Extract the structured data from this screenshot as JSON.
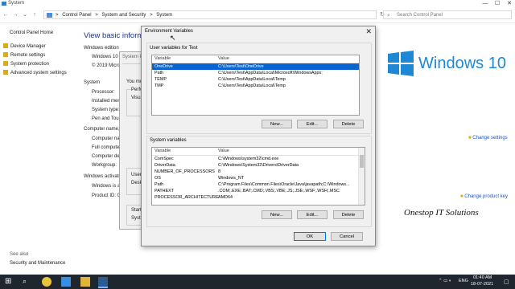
{
  "window": {
    "title": "System",
    "controls": [
      "—",
      "☐",
      "✕"
    ]
  },
  "address": {
    "path_items": [
      "Control Panel",
      "System and Security",
      "System"
    ],
    "separator": ">",
    "search_placeholder": "Search Control Panel"
  },
  "left_pane": {
    "home": "Control Panel Home",
    "links": [
      "Device Manager",
      "Remote settings",
      "System protection",
      "Advanced system settings"
    ],
    "see_also": "See also",
    "security": "Security and Maintenance"
  },
  "main": {
    "heading": "View basic information",
    "windows_edition": "Windows edition",
    "edition_value": "Windows 10 P",
    "copyright": "© 2019 Micros",
    "system_section": "System",
    "system_labels": [
      "Processor:",
      "Installed mem",
      "System type:",
      "Pen and Touch"
    ],
    "computer_section": "Computer name, d",
    "computer_labels": [
      "Computer nam",
      "Full compute",
      "Computer des",
      "Workgroup:"
    ],
    "activation_section": "Windows activatio",
    "activation_labels": [
      "Windows is ac",
      "Product ID: 00"
    ],
    "change_settings": "Change settings",
    "change_product_key": "Change product key",
    "win10_text": "Windows 10",
    "brand": "Onestop IT Solutions"
  },
  "bg_dialog": {
    "title": "System Pro",
    "lines": [
      "You mu",
      "Perfor",
      "Visua",
      "User P",
      "Deskt",
      "Startu",
      "Syste"
    ]
  },
  "env_dialog": {
    "title": "Environment Variables",
    "user_group": "User variables for Test",
    "columns": [
      "Variable",
      "Value"
    ],
    "user_vars": [
      {
        "name": "OneDrive",
        "value": "C:\\Users\\Test\\OneDrive",
        "selected": true
      },
      {
        "name": "Path",
        "value": "C:\\Users\\Test\\AppData\\Local\\Microsoft\\WindowsApps;",
        "selected": false
      },
      {
        "name": "TEMP",
        "value": "C:\\Users\\Test\\AppData\\Local\\Temp",
        "selected": false
      },
      {
        "name": "TMP",
        "value": "C:\\Users\\Test\\AppData\\Local\\Temp",
        "selected": false
      }
    ],
    "system_group": "System variables",
    "system_vars": [
      {
        "name": "ComSpec",
        "value": "C:\\Windows\\system32\\cmd.exe"
      },
      {
        "name": "DriverData",
        "value": "C:\\Windows\\System32\\Drivers\\DriverData"
      },
      {
        "name": "NUMBER_OF_PROCESSORS",
        "value": "8"
      },
      {
        "name": "OS",
        "value": "Windows_NT"
      },
      {
        "name": "Path",
        "value": "C:\\Program Files\\Common Files\\Oracle\\Java\\javapath;C:\\Windows..."
      },
      {
        "name": "PATHEXT",
        "value": ".COM;.EXE;.BAT;.CMD;.VBS;.VBE;.JS;.JSE;.WSF;.WSH;.MSC"
      },
      {
        "name": "PROCESSOR_ARCHITECTURE",
        "value": "AMD64"
      }
    ],
    "buttons": {
      "new": "New...",
      "edit": "Edit...",
      "delete": "Delete",
      "ok": "OK",
      "cancel": "Cancel"
    }
  },
  "taskbar": {
    "time": "01:40 AM",
    "date": "18-07-2021",
    "lang": "ENG"
  },
  "colors": {
    "selection": "#0a64d0",
    "link": "#1a56c4",
    "heading": "#1e3287",
    "taskbar": "#20262e",
    "win_blue": "#1e88d4"
  }
}
